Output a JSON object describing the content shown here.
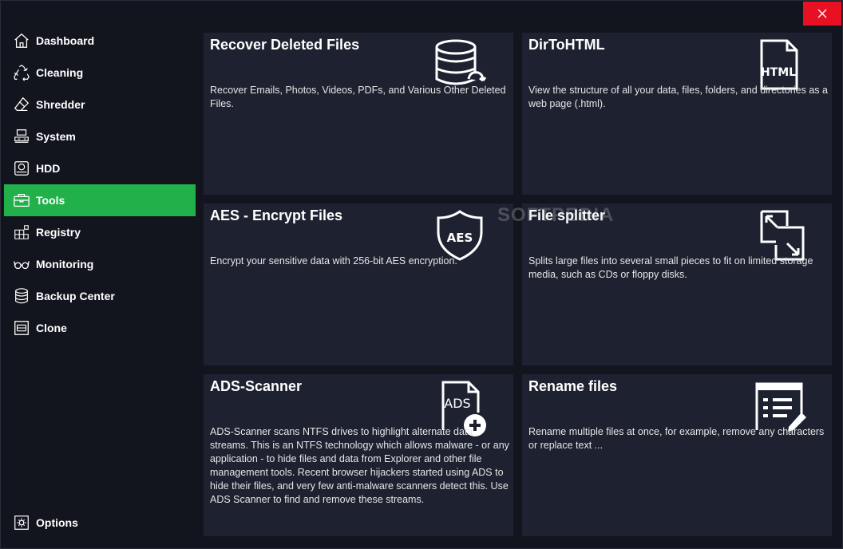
{
  "window": {
    "close_label": "✕"
  },
  "sidebar": {
    "items": [
      {
        "label": "Dashboard",
        "icon": "home-icon"
      },
      {
        "label": "Cleaning",
        "icon": "recycle-icon"
      },
      {
        "label": "Shredder",
        "icon": "eraser-icon"
      },
      {
        "label": "System",
        "icon": "system-icon"
      },
      {
        "label": "HDD",
        "icon": "hdd-icon"
      },
      {
        "label": "Tools",
        "icon": "toolbox-icon",
        "active": true
      },
      {
        "label": "Registry",
        "icon": "registry-icon"
      },
      {
        "label": "Monitoring",
        "icon": "glasses-icon"
      },
      {
        "label": "Backup Center",
        "icon": "database-icon"
      },
      {
        "label": "Clone",
        "icon": "clone-icon"
      }
    ],
    "options": {
      "label": "Options",
      "icon": "gear-icon"
    }
  },
  "tools": [
    {
      "title": "Recover Deleted Files",
      "description": "Recover Emails, Photos, Videos, PDFs, and Various Other Deleted Files.",
      "icon": "database-restore-icon"
    },
    {
      "title": "DirToHTML",
      "description": "View the structure of all your data, files, folders, and directories as a web page (.html).",
      "icon": "html-file-icon",
      "icon_text": "HTML"
    },
    {
      "title": "AES - Encrypt Files",
      "description": "Encrypt your sensitive data with 256-bit AES encryption.",
      "icon": "aes-shield-icon",
      "icon_text": "AES"
    },
    {
      "title": "File splitter",
      "description": "Splits large files into several small pieces to fit on limited storage media, such as CDs or floppy disks.",
      "icon": "split-arrows-icon"
    },
    {
      "title": "ADS-Scanner",
      "description": "ADS-Scanner scans NTFS drives to highlight alternate data streams. This is an NTFS technology which allows malware - or any application - to hide files and data from Explorer and other file management tools. Recent browser hijackers started using ADS to hide their files, and very few anti-malware scanners detect this. Use ADS Scanner to find and remove these streams.",
      "icon": "ads-file-add-icon",
      "icon_text": "ADS"
    },
    {
      "title": "Rename files",
      "description": "Rename multiple files at once, for example, remove any characters or replace text ...",
      "icon": "rename-list-icon"
    }
  ],
  "watermark": "SOFTPEDIA",
  "colors": {
    "accent": "#22b04b",
    "card": "#1e2130",
    "background": "#13151e",
    "close": "#e81123"
  }
}
